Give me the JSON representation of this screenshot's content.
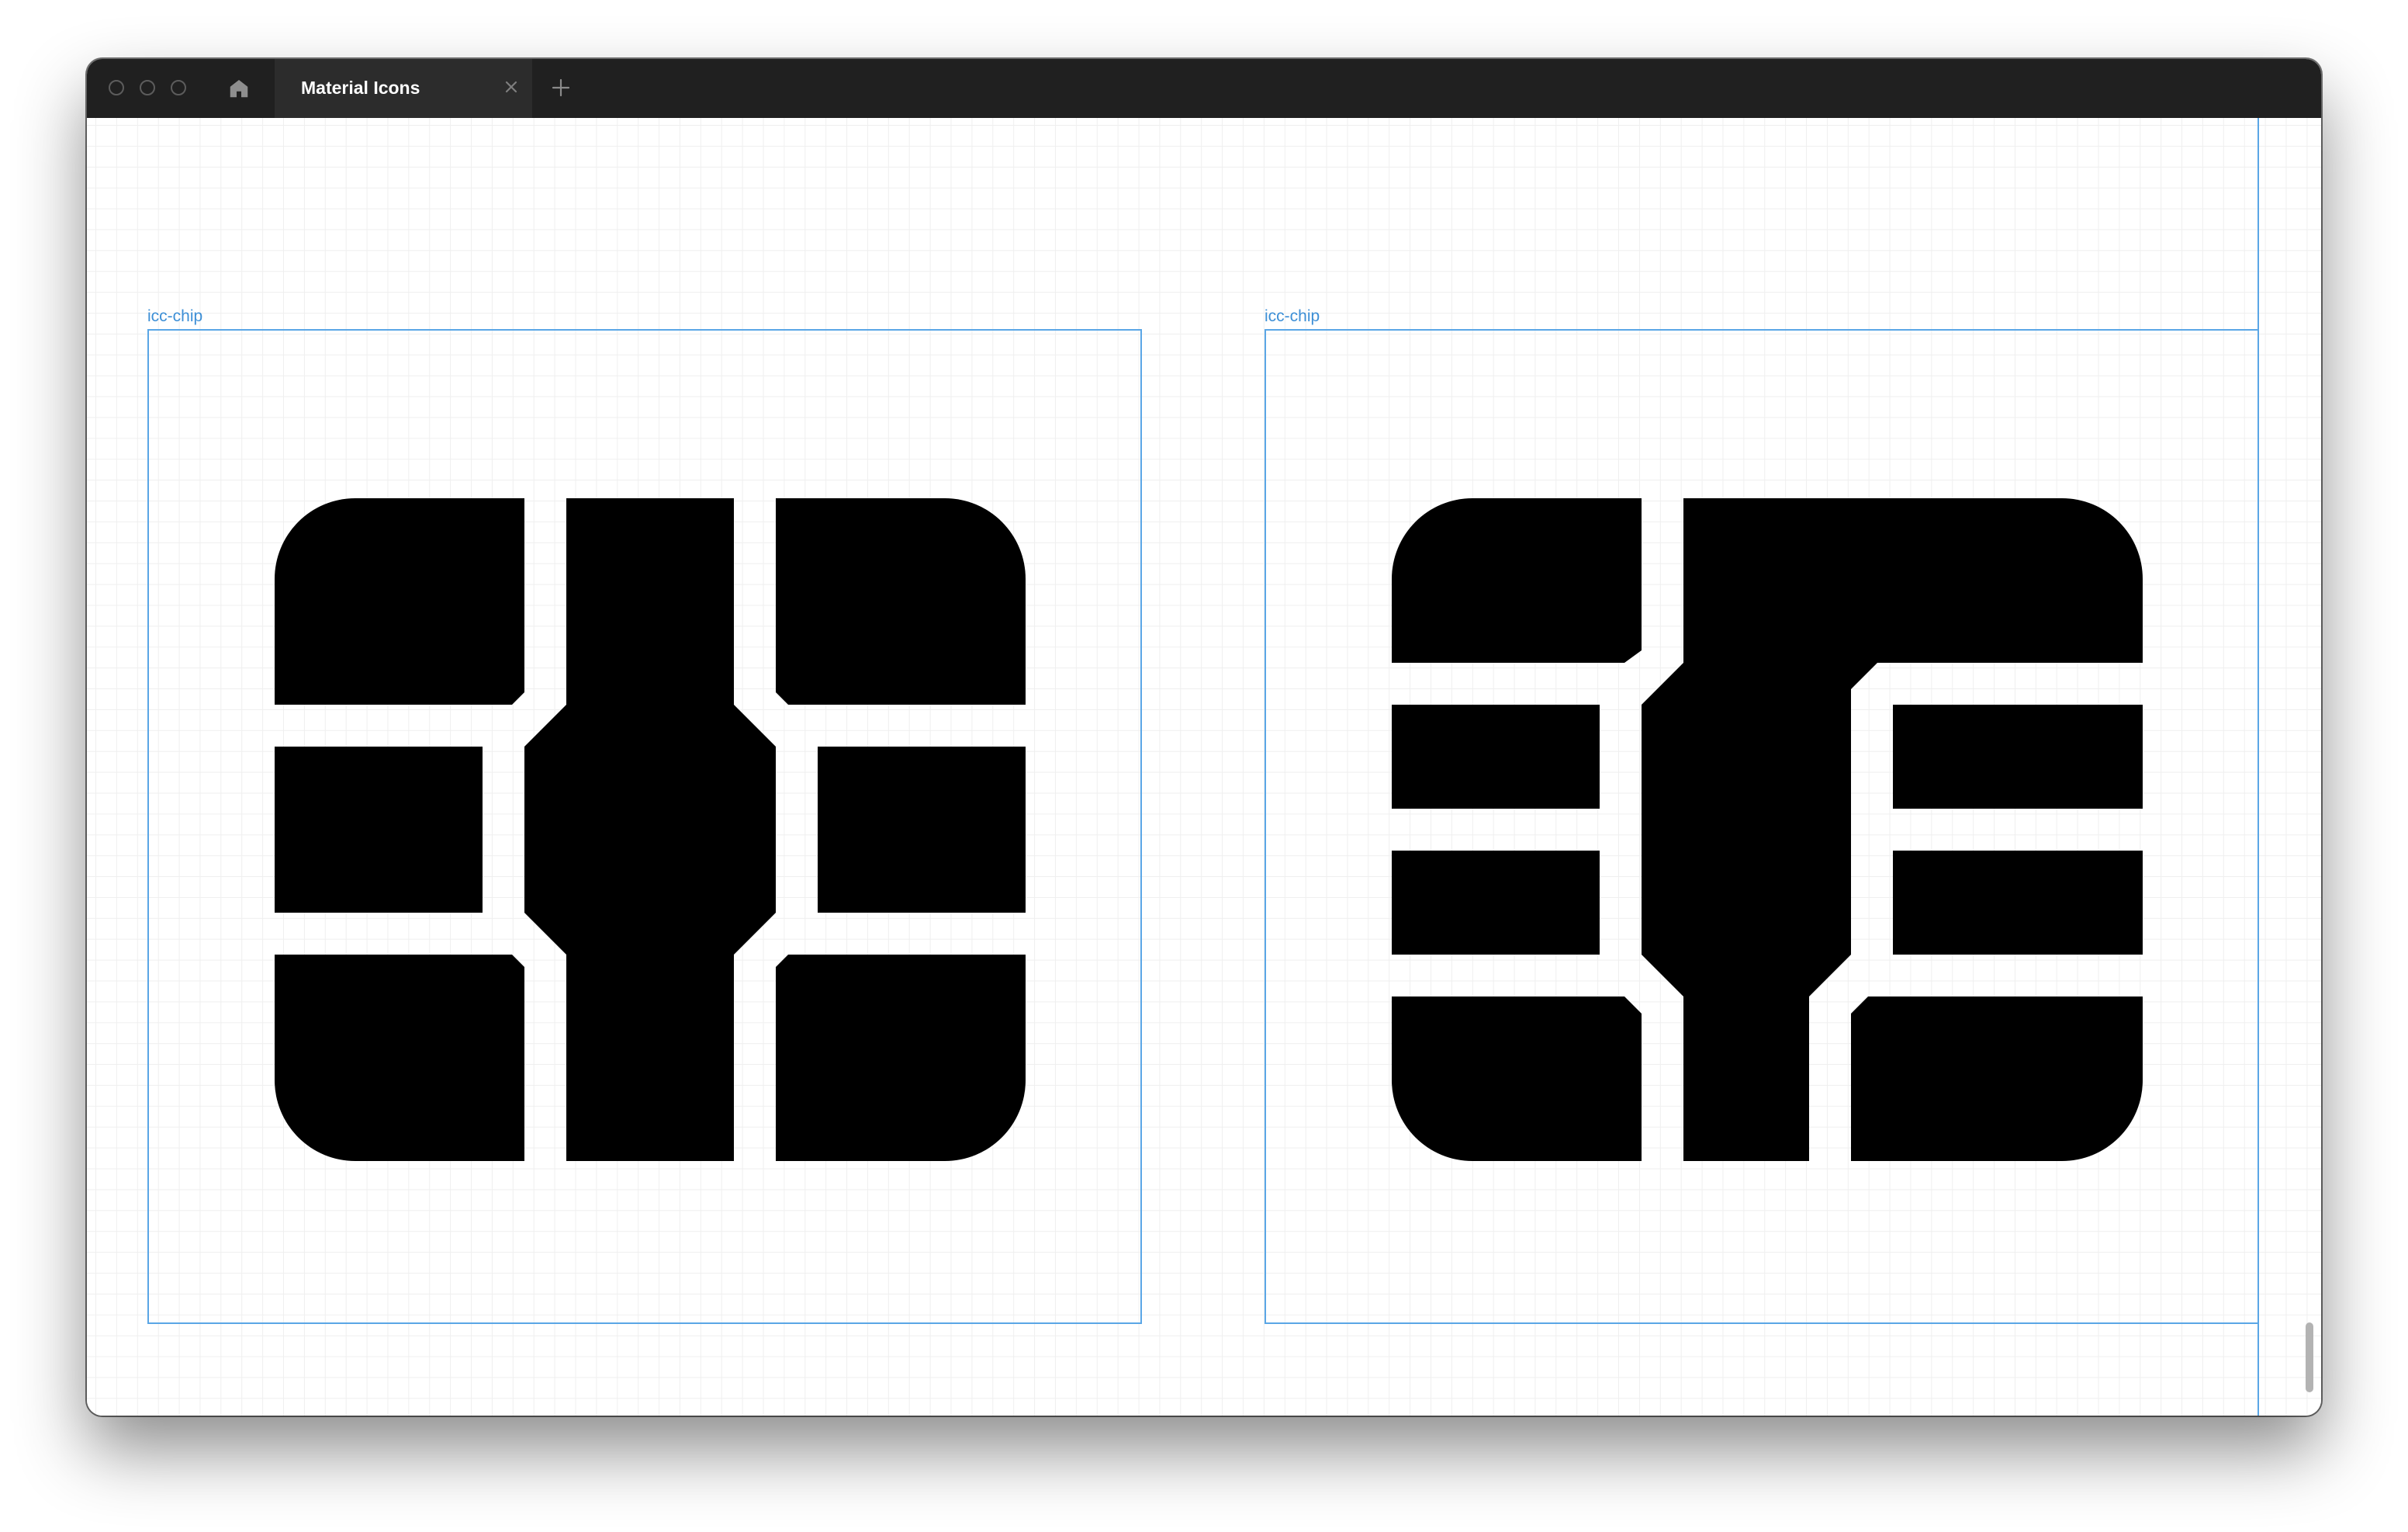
{
  "titlebar": {
    "tab_title": "Material Icons",
    "icons": {
      "window_controls": [
        "close-dot",
        "minimize-dot",
        "zoom-dot"
      ],
      "home": "home-icon",
      "tab_close": "close-icon",
      "new_tab": "plus-icon"
    }
  },
  "canvas": {
    "frames": [
      {
        "label": "icc-chip",
        "icon": "icc-chip-icon",
        "variant": "symmetric"
      },
      {
        "label": "icc-chip",
        "icon": "icc-chip-icon",
        "variant": "asymmetric"
      }
    ]
  },
  "colors": {
    "titlebar_bg": "#202020",
    "tab_bg": "#2c2c2c",
    "selection_blue": "#5aa6e6",
    "label_blue": "#3d8fd6",
    "icon_fill": "#000000",
    "grid": "#efefef"
  }
}
